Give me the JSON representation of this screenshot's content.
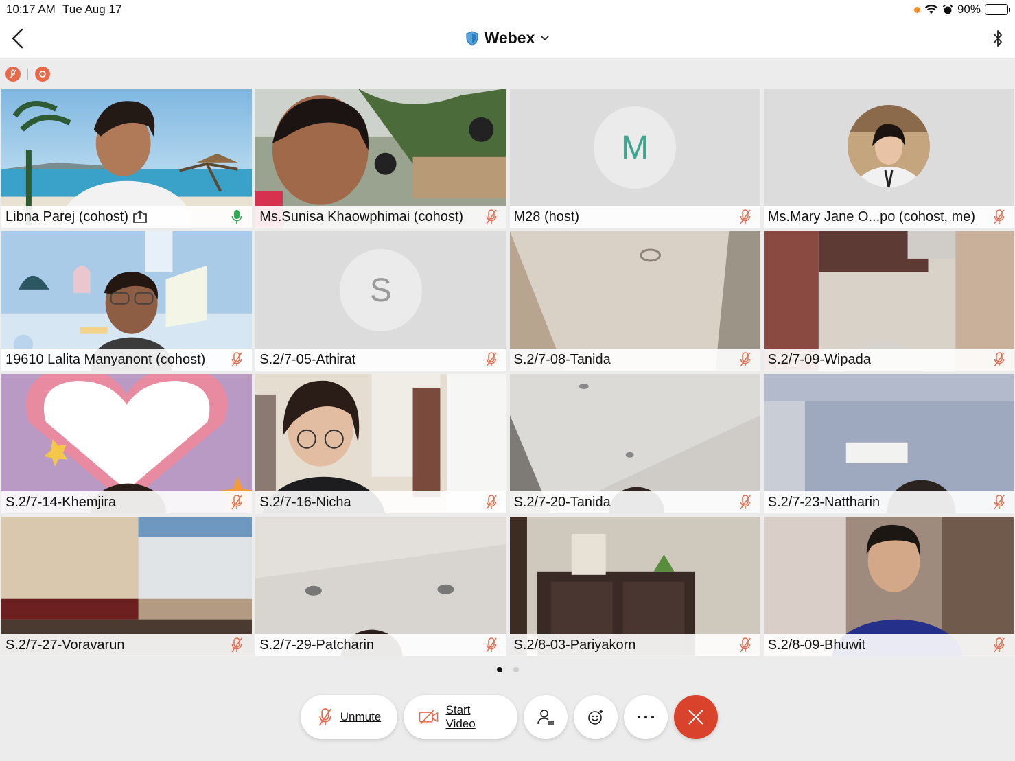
{
  "status": {
    "time": "10:17 AM",
    "date": "Tue Aug 17",
    "battery": "90%",
    "battery_fraction": 0.9
  },
  "nav": {
    "title": "Webex"
  },
  "participants": [
    {
      "name": "Libna Parej (cohost)",
      "mic": "active"
    },
    {
      "name": "Ms.Sunisa Khaowphimai (cohost)",
      "mic": "muted"
    },
    {
      "name": "M28 (host)",
      "mic": "muted",
      "initial": "M"
    },
    {
      "name": "Ms.Mary Jane O...po (cohost, me)",
      "mic": "muted"
    },
    {
      "name": "19610 Lalita Manyanont (cohost)",
      "mic": "muted"
    },
    {
      "name": "S.2/7-05-Athirat",
      "mic": "muted",
      "initial": "S"
    },
    {
      "name": "S.2/7-08-Tanida",
      "mic": "muted"
    },
    {
      "name": "S.2/7-09-Wipada",
      "mic": "muted"
    },
    {
      "name": "S.2/7-14-Khemjira",
      "mic": "muted"
    },
    {
      "name": "S.2/7-16-Nicha",
      "mic": "muted"
    },
    {
      "name": "S.2/7-20-Tanida",
      "mic": "muted"
    },
    {
      "name": "S.2/7-23-Nattharin",
      "mic": "muted"
    },
    {
      "name": "S.2/7-27-Voravarun",
      "mic": "muted"
    },
    {
      "name": "S.2/7-29-Patcharin",
      "mic": "muted"
    },
    {
      "name": "S.2/8-03-Pariyakorn",
      "mic": "muted"
    },
    {
      "name": "S.2/8-09-Bhuwit",
      "mic": "muted"
    }
  ],
  "controls": {
    "unmute": "Unmute",
    "start_video": "Start Video"
  },
  "colors": {
    "accent": "#2b7fb8",
    "end": "#d9432c",
    "muted": "#e8694a",
    "active_mic": "#2fa84f"
  }
}
